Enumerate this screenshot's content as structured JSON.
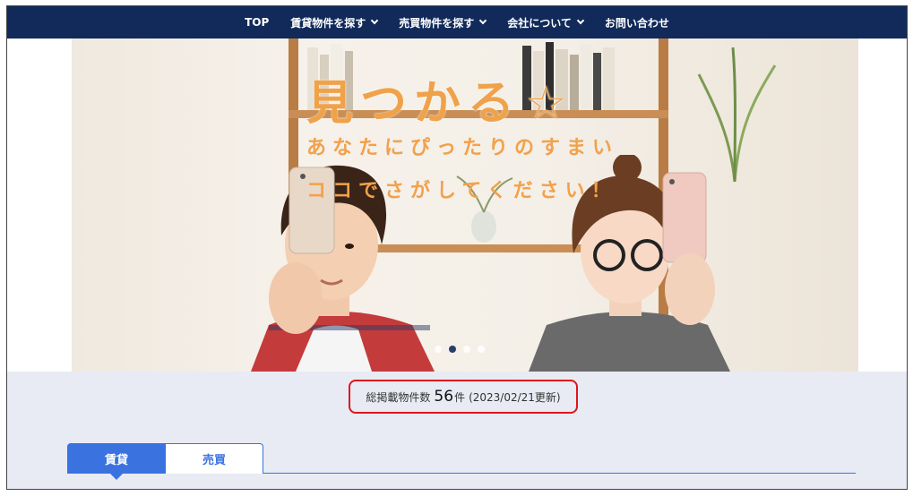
{
  "nav": {
    "items": [
      {
        "label": "TOP",
        "dropdown": false
      },
      {
        "label": "賃貸物件を探す",
        "dropdown": true
      },
      {
        "label": "売買物件を探す",
        "dropdown": true
      },
      {
        "label": "会社について",
        "dropdown": true
      },
      {
        "label": "お問い合わせ",
        "dropdown": false
      }
    ]
  },
  "hero": {
    "headline": "見つかる",
    "headline_star": "☆",
    "line1": "あなたにぴったりのすまい",
    "line2": "ココでさがしてください！",
    "slides_total": 4,
    "slide_active": 2
  },
  "listing_count": {
    "prefix": "総掲載物件数",
    "number": "56",
    "unit": "件",
    "updated": "(2023/02/21更新)"
  },
  "tabs": {
    "rent": "賃貸",
    "sale": "売買"
  },
  "colors": {
    "nav_bg": "#112a5a",
    "accent": "#3a73e0",
    "highlight": "#e0141c",
    "headline": "#f0a24a"
  }
}
